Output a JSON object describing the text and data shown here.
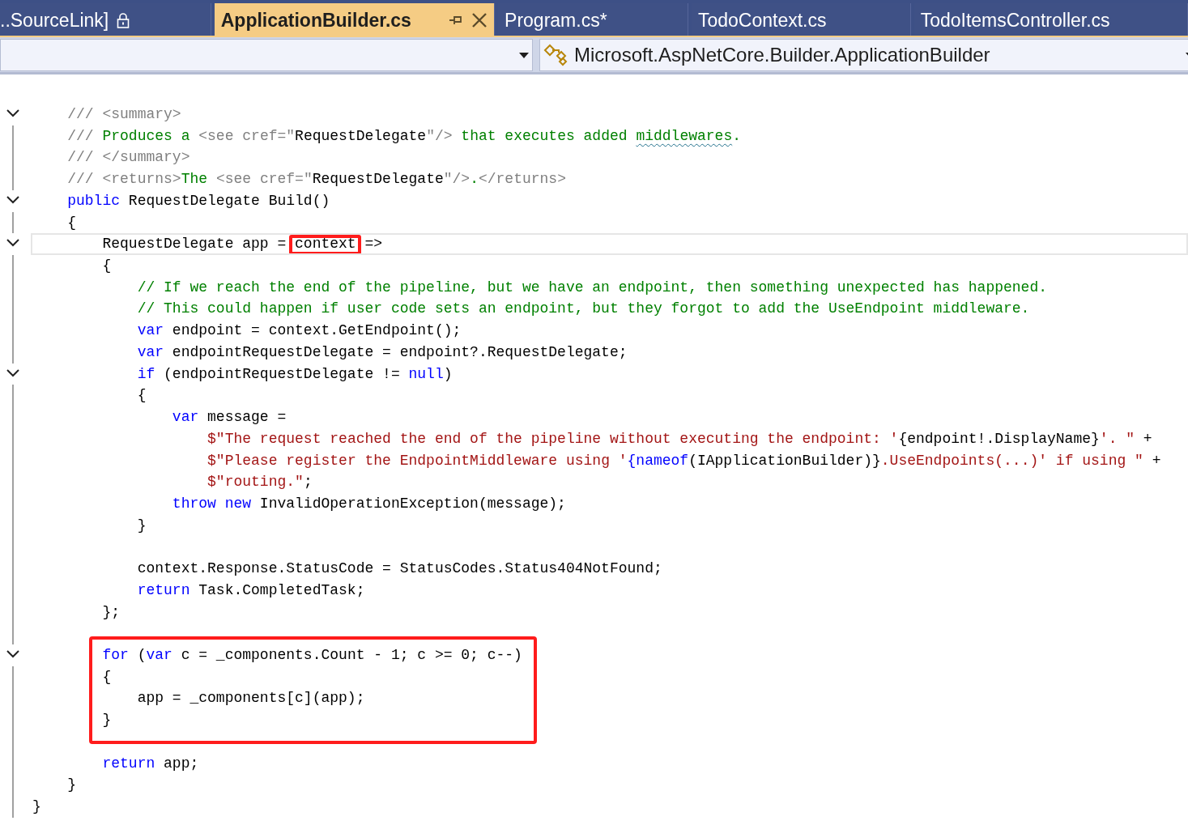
{
  "tabs": [
    {
      "label": "..SourceLink]",
      "selected": false,
      "locked": true
    },
    {
      "label": "ApplicationBuilder.cs",
      "selected": true,
      "locked": false
    },
    {
      "label": "Program.cs*",
      "selected": false,
      "locked": false
    },
    {
      "label": "TodoContext.cs",
      "selected": false,
      "locked": false
    },
    {
      "label": "TodoItemsController.cs",
      "selected": false,
      "locked": false
    }
  ],
  "navigation_bar": {
    "type_dropdown": {
      "value": "Microsoft.AspNetCore.Builder.ApplicationBuilder"
    }
  },
  "code_lines": [
    {
      "kind": "code",
      "fold": true,
      "tokens": [
        {
          "kind": "doc",
          "text": "    /// <summary>"
        }
      ]
    },
    {
      "kind": "code",
      "tokens": [
        {
          "kind": "doc",
          "text": "    /// "
        },
        {
          "kind": "comment",
          "text": "Produces a "
        },
        {
          "kind": "doc",
          "text": "<see cref=\""
        },
        {
          "kind": "plain",
          "text": "RequestDelegate"
        },
        {
          "kind": "doc",
          "text": "\"/>"
        },
        {
          "kind": "comment",
          "text": " that executes added "
        },
        {
          "kind": "comment",
          "text": "middlewares",
          "squiggle": true
        },
        {
          "kind": "comment",
          "text": "."
        }
      ]
    },
    {
      "kind": "code",
      "tokens": [
        {
          "kind": "doc",
          "text": "    /// </summary>"
        }
      ]
    },
    {
      "kind": "code",
      "tokens": [
        {
          "kind": "doc",
          "text": "    /// <returns>"
        },
        {
          "kind": "comment",
          "text": "The "
        },
        {
          "kind": "doc",
          "text": "<see cref=\""
        },
        {
          "kind": "plain",
          "text": "RequestDelegate"
        },
        {
          "kind": "doc",
          "text": "\"/>"
        },
        {
          "kind": "comment",
          "text": "."
        },
        {
          "kind": "doc",
          "text": "</returns>"
        }
      ]
    },
    {
      "kind": "code",
      "fold": true,
      "tokens": [
        {
          "kind": "keyword",
          "text": "    public"
        },
        {
          "kind": "plain",
          "text": " RequestDelegate Build()"
        }
      ]
    },
    {
      "kind": "code",
      "tokens": [
        {
          "kind": "plain",
          "text": "    {"
        }
      ]
    },
    {
      "kind": "code",
      "fold": true,
      "current": true,
      "tokens": [
        {
          "kind": "plain",
          "text": "        RequestDelegate app = "
        },
        {
          "kind": "plain",
          "text": "context",
          "boxed": true
        },
        {
          "kind": "plain",
          "text": " =>"
        }
      ]
    },
    {
      "kind": "code",
      "tokens": [
        {
          "kind": "plain",
          "text": "        {"
        }
      ]
    },
    {
      "kind": "code",
      "tokens": [
        {
          "kind": "comment",
          "text": "            // If we reach the end of the pipeline, but we have an endpoint, then something unexpected has happened."
        }
      ]
    },
    {
      "kind": "code",
      "tokens": [
        {
          "kind": "comment",
          "text": "            // This could happen if user code sets an endpoint, but they forgot to add the UseEndpoint middleware."
        }
      ]
    },
    {
      "kind": "code",
      "tokens": [
        {
          "kind": "keyword",
          "text": "            var"
        },
        {
          "kind": "plain",
          "text": " endpoint = context.GetEndpoint();"
        }
      ]
    },
    {
      "kind": "code",
      "tokens": [
        {
          "kind": "keyword",
          "text": "            var"
        },
        {
          "kind": "plain",
          "text": " endpointRequestDelegate = endpoint?.RequestDelegate;"
        }
      ]
    },
    {
      "kind": "code",
      "fold": true,
      "tokens": [
        {
          "kind": "keyword",
          "text": "            if"
        },
        {
          "kind": "plain",
          "text": " (endpointRequestDelegate != "
        },
        {
          "kind": "keyword",
          "text": "null"
        },
        {
          "kind": "plain",
          "text": ")"
        }
      ]
    },
    {
      "kind": "code",
      "tokens": [
        {
          "kind": "plain",
          "text": "            {"
        }
      ]
    },
    {
      "kind": "code",
      "tokens": [
        {
          "kind": "keyword",
          "text": "                var"
        },
        {
          "kind": "plain",
          "text": " message ="
        }
      ]
    },
    {
      "kind": "code",
      "tokens": [
        {
          "kind": "string",
          "text": "                    $\"The request reached the end of the pipeline without executing the endpoint: '"
        },
        {
          "kind": "plain",
          "text": "{endpoint!.DisplayName}"
        },
        {
          "kind": "string",
          "text": "'. \""
        },
        {
          "kind": "plain",
          "text": " +"
        }
      ]
    },
    {
      "kind": "code",
      "tokens": [
        {
          "kind": "string",
          "text": "                    $\"Please register the EndpointMiddleware using '"
        },
        {
          "kind": "keyword",
          "text": "{nameof"
        },
        {
          "kind": "plain",
          "text": "(IApplicationBuilder)}"
        },
        {
          "kind": "string",
          "text": ".UseEndpoints(...)' if using \""
        },
        {
          "kind": "plain",
          "text": " +"
        }
      ]
    },
    {
      "kind": "code",
      "tokens": [
        {
          "kind": "string",
          "text": "                    $\"routing.\""
        },
        {
          "kind": "plain",
          "text": ";"
        }
      ]
    },
    {
      "kind": "code",
      "tokens": [
        {
          "kind": "keyword",
          "text": "                throw"
        },
        {
          "kind": "keyword",
          "text": " new"
        },
        {
          "kind": "plain",
          "text": " InvalidOperationException(message);"
        }
      ]
    },
    {
      "kind": "code",
      "tokens": [
        {
          "kind": "plain",
          "text": "            }"
        }
      ]
    },
    {
      "kind": "blank"
    },
    {
      "kind": "code",
      "tokens": [
        {
          "kind": "plain",
          "text": "            context.Response.StatusCode = StatusCodes.Status404NotFound;"
        }
      ]
    },
    {
      "kind": "code",
      "tokens": [
        {
          "kind": "keyword",
          "text": "            return"
        },
        {
          "kind": "plain",
          "text": " Task.CompletedTask;"
        }
      ]
    },
    {
      "kind": "code",
      "tokens": [
        {
          "kind": "plain",
          "text": "        };"
        }
      ]
    },
    {
      "kind": "blank"
    },
    {
      "kind": "code",
      "fold": true,
      "boxed": true,
      "tokens": [
        {
          "kind": "keyword",
          "text": "        for"
        },
        {
          "kind": "plain",
          "text": " ("
        },
        {
          "kind": "keyword",
          "text": "var"
        },
        {
          "kind": "plain",
          "text": " c = _components.Count - 1; c >= 0; c--)"
        }
      ]
    },
    {
      "kind": "code",
      "boxed": true,
      "tokens": [
        {
          "kind": "plain",
          "text": "        {"
        }
      ]
    },
    {
      "kind": "code",
      "boxed": true,
      "tokens": [
        {
          "kind": "plain",
          "text": "            app = _components[c](app);"
        }
      ]
    },
    {
      "kind": "code",
      "boxed": true,
      "tokens": [
        {
          "kind": "plain",
          "text": "        }"
        }
      ]
    },
    {
      "kind": "blank"
    },
    {
      "kind": "code",
      "tokens": [
        {
          "kind": "keyword",
          "text": "        return"
        },
        {
          "kind": "plain",
          "text": " app;"
        }
      ]
    },
    {
      "kind": "code",
      "tokens": [
        {
          "kind": "plain",
          "text": "    }"
        }
      ]
    },
    {
      "kind": "code",
      "tokens": [
        {
          "kind": "plain",
          "text": "}"
        }
      ]
    }
  ]
}
